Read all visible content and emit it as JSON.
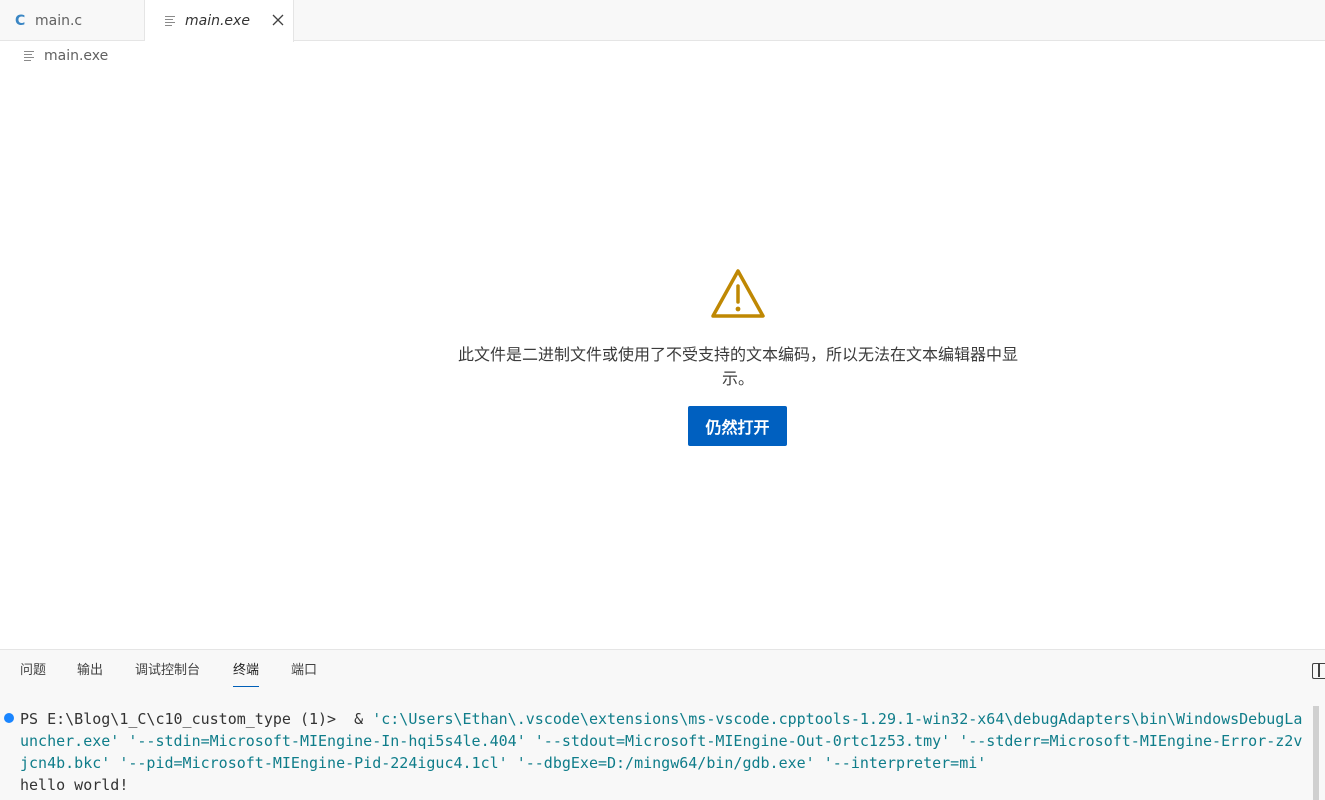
{
  "tabs": [
    {
      "icon": "C",
      "label": "main.c"
    },
    {
      "label": "main.exe"
    }
  ],
  "breadcrumb": {
    "label": "main.exe"
  },
  "notice": {
    "message": "此文件是二进制文件或使用了不受支持的文本编码，所以无法在文本编辑器中显示。",
    "button": "仍然打开"
  },
  "panel": {
    "tabs": [
      "问题",
      "输出",
      "调试控制台",
      "终端",
      "端口"
    ],
    "active_tab": "终端"
  },
  "terminal": {
    "prompt": "PS E:\\Blog\\1_C\\c10_custom_type (1)>  & ",
    "command": "'c:\\Users\\Ethan\\.vscode\\extensions\\ms-vscode.cpptools-1.29.1-win32-x64\\debugAdapters\\bin\\WindowsDebugLauncher.exe' '--stdin=Microsoft-MIEngine-In-hqi5s4le.404' '--stdout=Microsoft-MIEngine-Out-0rtc1z53.tmy' '--stderr=Microsoft-MIEngine-Error-z2vjcn4b.bkc' '--pid=Microsoft-MIEngine-Pid-224iguc4.1cl' '--dbgExe=D:/mingw64/bin/gdb.exe' '--interpreter=mi'",
    "output": "hello world!"
  },
  "colors": {
    "accent": "#0060c0",
    "warning": "#bf8803"
  }
}
